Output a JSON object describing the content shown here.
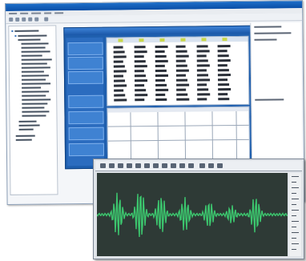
{
  "colors": {
    "title_bar": "#1e6fc9",
    "dialog": "#1f5fae",
    "header_marks": "#c9d84a",
    "waveform": "#3cc66e",
    "waveform_background": "#2e3a36"
  },
  "icons": {
    "window_toolbar": [
      "toolbar-button-icon"
    ],
    "wave_toolbar": [
      "waveform-tool-icon"
    ]
  }
}
